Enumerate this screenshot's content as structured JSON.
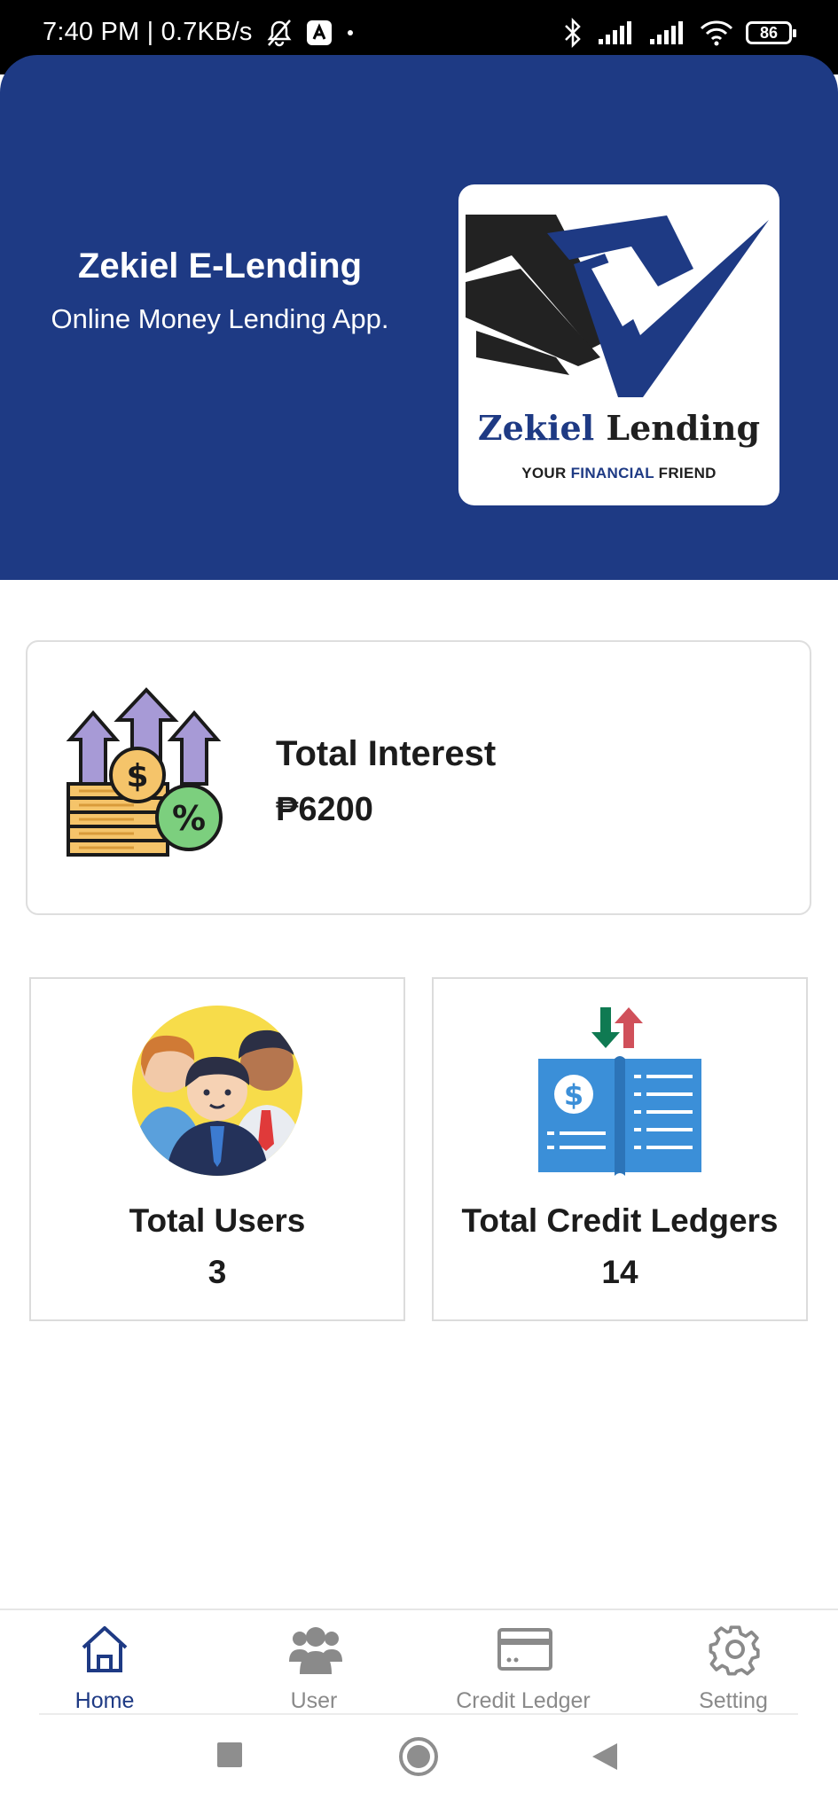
{
  "status_bar": {
    "time_speed": "7:40 PM | 0.7KB/s",
    "battery": "86"
  },
  "header": {
    "app_title": "Zekiel E-Lending",
    "app_subtitle": "Online Money Lending App.",
    "logo": {
      "name_part1": "Zekiel",
      "name_part2": "Lending",
      "tagline_part1": "YOUR",
      "tagline_part2": "FINANCIAL",
      "tagline_part3": "FRIEND"
    }
  },
  "interest_card": {
    "label": "Total Interest",
    "value": "₱6200",
    "icon": "interest-growth-icon"
  },
  "stats": {
    "users": {
      "label": "Total Users",
      "value": "3",
      "icon": "users-group-icon"
    },
    "ledgers": {
      "label": "Total Credit Ledgers",
      "value": "14",
      "icon": "ledger-book-icon"
    }
  },
  "bottom_nav": {
    "items": [
      {
        "label": "Home",
        "icon": "home-icon",
        "active": true
      },
      {
        "label": "User",
        "icon": "users-icon",
        "active": false
      },
      {
        "label": "Credit Ledger",
        "icon": "credit-card-icon",
        "active": false
      },
      {
        "label": "Setting",
        "icon": "gear-icon",
        "active": false
      }
    ]
  },
  "colors": {
    "primary": "#1e3a84",
    "inactive": "#8a8a8a",
    "down_arrow": "#0f7a52",
    "up_arrow": "#d0505a"
  }
}
